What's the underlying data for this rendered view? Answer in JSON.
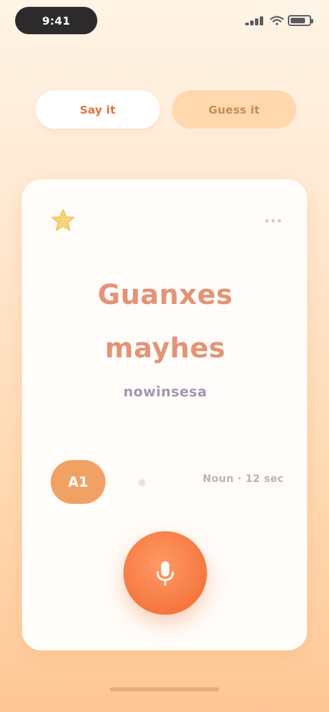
{
  "status_bar": {
    "time": "9:41",
    "battery_level": 0.8
  },
  "tabs": [
    {
      "label": "Say it"
    },
    {
      "label": "Guess it"
    }
  ],
  "card": {
    "word_lines": [
      "Guanxes",
      "mayhes"
    ],
    "subtitle": "nowinsesa",
    "level": "A1",
    "meta": "Noun · 12 sec"
  },
  "colors": {
    "accent": "#F5773F",
    "word": "#E49377",
    "card_bg": "#FFFCF9",
    "pill": "#F2A165"
  },
  "icons": {
    "badge": "star-icon",
    "menu": "more-icon",
    "mic": "microphone-icon"
  }
}
